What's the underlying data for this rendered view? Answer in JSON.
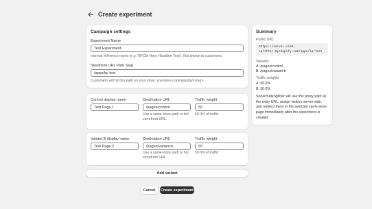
{
  "header": {
    "title": "Create experiment",
    "back_icon": "arrow-left-icon"
  },
  "campaign": {
    "title": "Campaign settings",
    "experiment_name": {
      "label": "Experiment Name",
      "value": "Test Experiment",
      "help": "Internal reference name (e.g. 'BFCM Hero Headline Test'). Not shown to customers."
    },
    "path_slug": {
      "label": "Storefront URL Path Slug",
      "value": "/apps/lp/ test",
      "help": "Customers will hit this path on your store: yourstore.com/apps/lp/<slug>"
    }
  },
  "control": {
    "name_label": "Control display name",
    "name_value": "Test Page 1",
    "dest_label": "Destination URL",
    "dest_value": "/pages/control",
    "dest_help": "Use a same-store path or full storefront URL.",
    "weight_label": "Traffic weight",
    "weight_value": "50",
    "weight_help": "50.0% of traffic"
  },
  "variant_b": {
    "name_label": "Variant B display name",
    "name_value": "Test Page 2",
    "dest_label": "Destination URL",
    "dest_value": "/pages/variant-b",
    "dest_help": "Use a same-store path or full storefront URL.",
    "weight_label": "Traffic weight",
    "weight_value": "50",
    "weight_help": "50.0% of traffic"
  },
  "actions": {
    "add_variant": "Add variant",
    "cancel": "Cancel",
    "create": "Create experiment"
  },
  "summary": {
    "title": "Summary",
    "public_url_label": "Public URL",
    "public_url_line1": "https://server-side-",
    "public_url_line2": "splitter.myshopify.com/apps/lp/test",
    "variants_label": "Variants",
    "variant_a": "A: /pages/control",
    "variant_b": "B: /pages/variant-b",
    "weights_label": "Traffic weights",
    "weight_a": "A: 50.0%",
    "weight_b": "B: 50.0%",
    "description": "ServerSideSplitter will use this proxy path as the entry URL, assign visitors server-side, and redirect them to the selected same-store page immediately after the experiment is created."
  }
}
